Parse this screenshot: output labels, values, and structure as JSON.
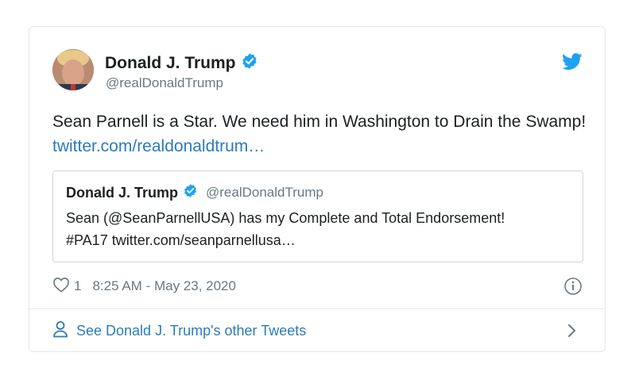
{
  "author": {
    "name": "Donald J. Trump",
    "handle": "@realDonaldTrump",
    "verified": true
  },
  "tweet": {
    "text": "Sean Parnell is a Star. We need him in Washington to Drain the Swamp!",
    "link_text": "twitter.com/realdonaldtrum…"
  },
  "quoted_tweet": {
    "name": "Donald J. Trump",
    "handle": "@realDonaldTrump",
    "text": "Sean (@SeanParnellUSA) has my Complete and Total Endorsement! #PA17 twitter.com/seanparnellusa…"
  },
  "meta": {
    "likes": "1",
    "timestamp": "8:25 AM - May 23, 2020"
  },
  "footer": {
    "label": "See Donald J. Trump's other Tweets"
  },
  "icons": {
    "verified": "verified-badge-icon",
    "brand": "twitter-bird-icon",
    "like": "heart-icon",
    "info": "info-icon",
    "user": "user-icon",
    "chevron": "chevron-right-icon"
  },
  "colors": {
    "accent": "#1da1f2",
    "link": "#2b7bb9",
    "text": "#1c2022",
    "muted": "#697882",
    "border": "#e1e8ed"
  }
}
